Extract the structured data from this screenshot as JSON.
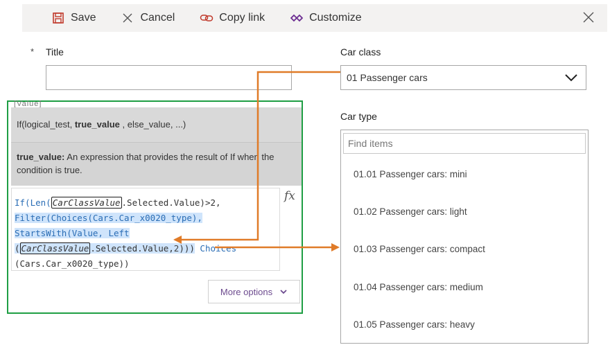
{
  "toolbar": {
    "save": "Save",
    "cancel": "Cancel",
    "copy_link": "Copy link",
    "customize": "Customize"
  },
  "form": {
    "title_label": "Title",
    "required_mark": "*",
    "title_value": "",
    "car_class_label": "Car class",
    "car_class_value": "01 Passenger cars",
    "car_type_label": "Car type",
    "find_placeholder": "Find items",
    "car_type_options": [
      "01.01 Passenger cars: mini",
      "01.02 Passenger cars: light",
      "01.03 Passenger cars: compact",
      "01.04 Passenger cars: medium",
      "01.05 Passenger cars: heavy"
    ]
  },
  "formula": {
    "hidden_label": "[Value]",
    "signature_prefix": "If(logical_test, ",
    "signature_param": "true_value",
    "signature_suffix": " , else_value, ...)",
    "param_name": "true_value:",
    "param_desc": " An expression that provides the result of If when the condition is true.",
    "code": {
      "if_len": "If(Len(",
      "ctl1": "CarClassValue",
      "sel1": ".Selected.Value)>2,",
      "filter": "Filter(Choices(Cars.Car_x0020_type),",
      "startswith": "StartsWith(Value, Left",
      "open": "(",
      "ctl2": "CarClassValue",
      "sel2": ".Selected.Value,",
      "two": "2",
      "close": ")))",
      "choices": " Choices",
      "last": "(Cars.Car_x0020_type))"
    },
    "fx_symbol": "fx",
    "more_options": "More options"
  },
  "colors": {
    "highlight_border": "#1e9e43",
    "arrow": "#e07b28",
    "code_blue": "#2a6db5",
    "selection": "#cfe4fb",
    "link_purple": "#6c4a8e"
  }
}
